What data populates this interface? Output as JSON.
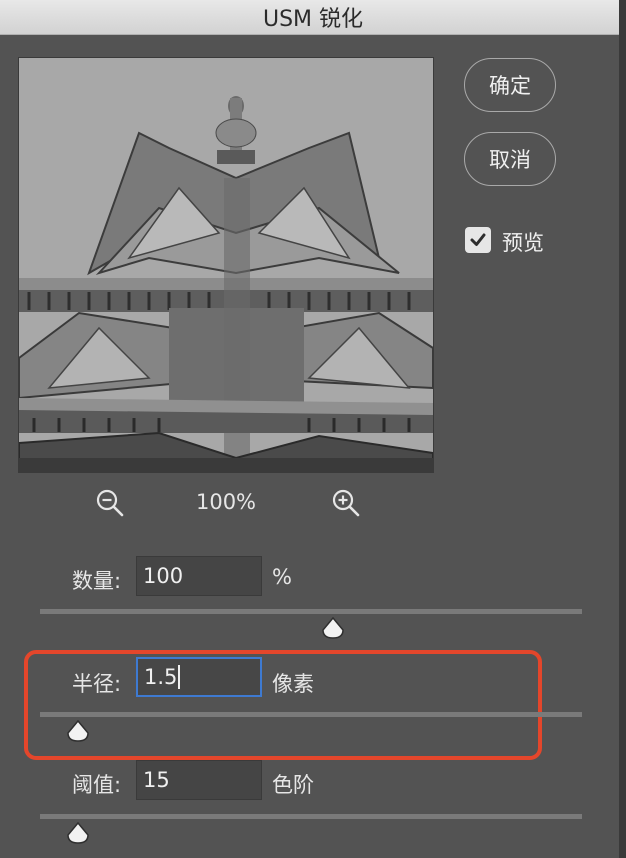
{
  "window": {
    "title": "USM 锐化"
  },
  "buttons": {
    "ok": "确定",
    "cancel": "取消"
  },
  "preview_toggle": {
    "label": "预览",
    "checked": true
  },
  "zoom": {
    "level": "100%"
  },
  "params": {
    "amount": {
      "label": "数量:",
      "value": "100",
      "unit": "%",
      "slider_fraction": 0.54
    },
    "radius": {
      "label": "半径:",
      "value": "1.5",
      "unit": "像素",
      "slider_fraction": 0.07
    },
    "threshold": {
      "label": "阈值:",
      "value": "15",
      "unit": "色阶",
      "slider_fraction": 0.07
    }
  },
  "colors": {
    "background": "#535353",
    "highlight": "#e4462b",
    "focus": "#3e7ad1"
  }
}
